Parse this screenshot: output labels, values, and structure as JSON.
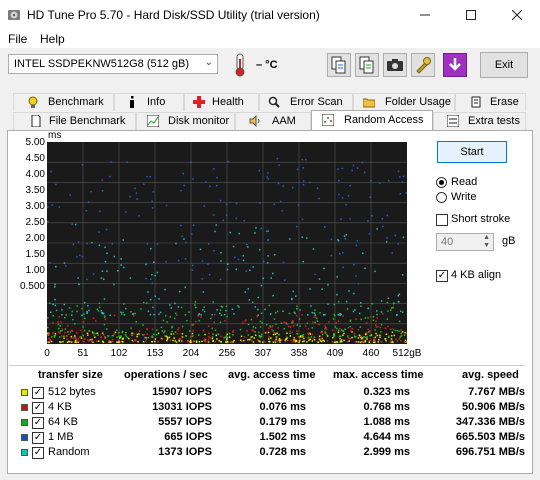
{
  "window": {
    "title": "HD Tune Pro 5.70 - Hard Disk/SSD Utility (trial version)"
  },
  "menu": {
    "file": "File",
    "help": "Help"
  },
  "toolbar": {
    "drive": "INTEL SSDPEKNW512G8 (512 gB)",
    "temperature": "– °C",
    "exit": "Exit"
  },
  "tabs_row1": [
    "Benchmark",
    "Info",
    "Health",
    "Error Scan",
    "Folder Usage",
    "Erase"
  ],
  "tabs_row2": [
    "File Benchmark",
    "Disk monitor",
    "AAM",
    "Random Access",
    "Extra tests"
  ],
  "chart": {
    "y_unit": "ms",
    "y_ticks": [
      "5.00",
      "4.50",
      "4.00",
      "3.50",
      "3.00",
      "2.50",
      "2.00",
      "1.50",
      "1.00",
      "0.500"
    ],
    "x_ticks": [
      "0",
      "51",
      "102",
      "153",
      "204",
      "256",
      "307",
      "358",
      "409",
      "460",
      "512gB"
    ]
  },
  "chart_data": {
    "type": "scatter",
    "xlabel": "",
    "ylabel": "ms",
    "xlim": [
      0,
      512
    ],
    "ylim": [
      0,
      5
    ],
    "grid": true,
    "series": [
      {
        "name": "512 bytes",
        "color": "#e6e600",
        "y_range": [
          0.062,
          0.323
        ]
      },
      {
        "name": "4 KB",
        "color": "#e02020",
        "y_range": [
          0.076,
          0.768
        ]
      },
      {
        "name": "64 KB",
        "color": "#20c020",
        "y_range": [
          0.179,
          1.088
        ]
      },
      {
        "name": "1 MB",
        "color": "#2060e0",
        "y_range": [
          1.502,
          4.644
        ]
      },
      {
        "name": "Random",
        "color": "#20c0c0",
        "y_range": [
          0.728,
          2.999
        ]
      }
    ]
  },
  "controls": {
    "start": "Start",
    "read": "Read",
    "write": "Write",
    "short_stroke": "Short stroke",
    "stroke_value": "40",
    "stroke_unit": "gB",
    "align": "4 KB align"
  },
  "table": {
    "headers": [
      "transfer size",
      "operations / sec",
      "avg. access time",
      "max. access time",
      "avg. speed"
    ],
    "rows": [
      {
        "label": "512 bytes",
        "color": "#e6e600",
        "ops": "15907 IOPS",
        "avg": "0.062 ms",
        "max": "0.323 ms",
        "speed": "7.767 MB/s"
      },
      {
        "label": "4 KB",
        "color": "#d01010",
        "ops": "13031 IOPS",
        "avg": "0.076 ms",
        "max": "0.768 ms",
        "speed": "50.906 MB/s"
      },
      {
        "label": "64 KB",
        "color": "#10b010",
        "ops": "5557 IOPS",
        "avg": "0.179 ms",
        "max": "1.088 ms",
        "speed": "347.336 MB/s"
      },
      {
        "label": "1 MB",
        "color": "#1050d0",
        "ops": "665 IOPS",
        "avg": "1.502 ms",
        "max": "4.644 ms",
        "speed": "665.503 MB/s"
      },
      {
        "label": "Random",
        "color": "#10c0c0",
        "ops": "1373 IOPS",
        "avg": "0.728 ms",
        "max": "2.999 ms",
        "speed": "696.751 MB/s"
      }
    ]
  }
}
